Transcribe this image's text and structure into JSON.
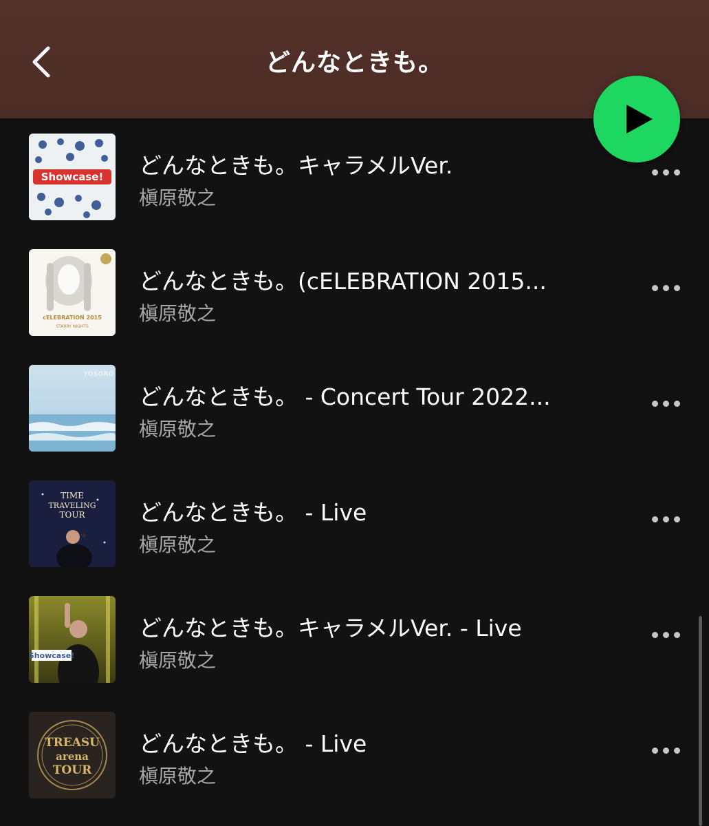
{
  "header": {
    "title": "どんなときも。",
    "background_color": "#55302a"
  },
  "play_button": {
    "color": "#1ed760"
  },
  "tracks": [
    {
      "title": "どんなときも。キャラメルVer.",
      "artist": "槇原敬之",
      "cover_icon": "showcase-album-art"
    },
    {
      "title": "どんなときも。(cELEBRATION 2015...",
      "artist": "槇原敬之",
      "cover_icon": "celebration-2015-album-art"
    },
    {
      "title": "どんなときも。 - Concert Tour 2022...",
      "artist": "槇原敬之",
      "cover_icon": "yosoro-album-art"
    },
    {
      "title": "どんなときも。 - Live",
      "artist": "槇原敬之",
      "cover_icon": "time-traveling-tour-album-art"
    },
    {
      "title": "どんなときも。キャラメルVer. - Live",
      "artist": "槇原敬之",
      "cover_icon": "showcase-live-album-art"
    },
    {
      "title": "どんなときも。 - Live",
      "artist": "槇原敬之",
      "cover_icon": "treasure-arena-tour-album-art"
    }
  ]
}
